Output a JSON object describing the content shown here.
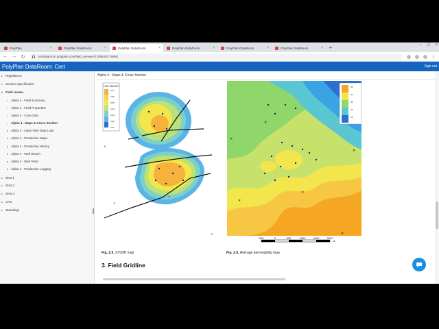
{
  "browser": {
    "tabs": [
      {
        "label": "PolyPlan"
      },
      {
        "label": "PolyPlan DataRoom"
      },
      {
        "label": "PolyPlan DataRoom"
      },
      {
        "label": "PolyPlan DataRoom"
      },
      {
        "label": "PolyPlan DataRoom"
      },
      {
        "label": "PolyPlan DataRoom"
      }
    ],
    "url": "cretdataroom.polyplan.com/field_review/4719564/4719650"
  },
  "app": {
    "title": "PolyPlan DataRoom: Cret",
    "signout": "Sign out"
  },
  "sidebar": {
    "items": [
      {
        "label": "Regulations"
      },
      {
        "label": "Session specification"
      },
      {
        "label": "Field review"
      },
      {
        "label": "Alpha 4 - Field Summary"
      },
      {
        "label": "Alpha 4 - Fluid Properties"
      },
      {
        "label": "Alpha 4 - Core Data"
      },
      {
        "label": "Alpha 4 - Maps & Cross-Section"
      },
      {
        "label": "Alpha 4 - Open Hole Data Logs"
      },
      {
        "label": "Alpha 4 - Production Maps"
      },
      {
        "label": "Alpha 4 - Production History"
      },
      {
        "label": "Alpha 4 - Well Sketch"
      },
      {
        "label": "Alpha 4 - Well Tests"
      },
      {
        "label": "Alpha 4 - Production Logging"
      },
      {
        "label": "Shot 1"
      },
      {
        "label": "Shot 2"
      },
      {
        "label": "Shot 3"
      },
      {
        "label": "CAS"
      },
      {
        "label": "Standings"
      }
    ]
  },
  "content": {
    "breadcrumb": "Alpha 4 - Maps & Cross-Section",
    "fig1": {
      "num": "Fig. 2.5.",
      "text": "STOIIP map",
      "legend_title": "OIIP, MMUNIT",
      "legend_ticks": [
        "0.07",
        "0.06",
        "0.05",
        "0.04",
        "0.03",
        "0.02",
        "0.01"
      ]
    },
    "fig2": {
      "num": "Fig. 2.6.",
      "text": "Average permeability map",
      "legend_ticks": [
        "55",
        "45",
        "35",
        "25",
        "15"
      ],
      "scale_ticks": [
        "800",
        "0",
        "800",
        "1600",
        "2400",
        "3200"
      ],
      "scale_unit": "м"
    },
    "section_title": "3. Field Gridline"
  }
}
